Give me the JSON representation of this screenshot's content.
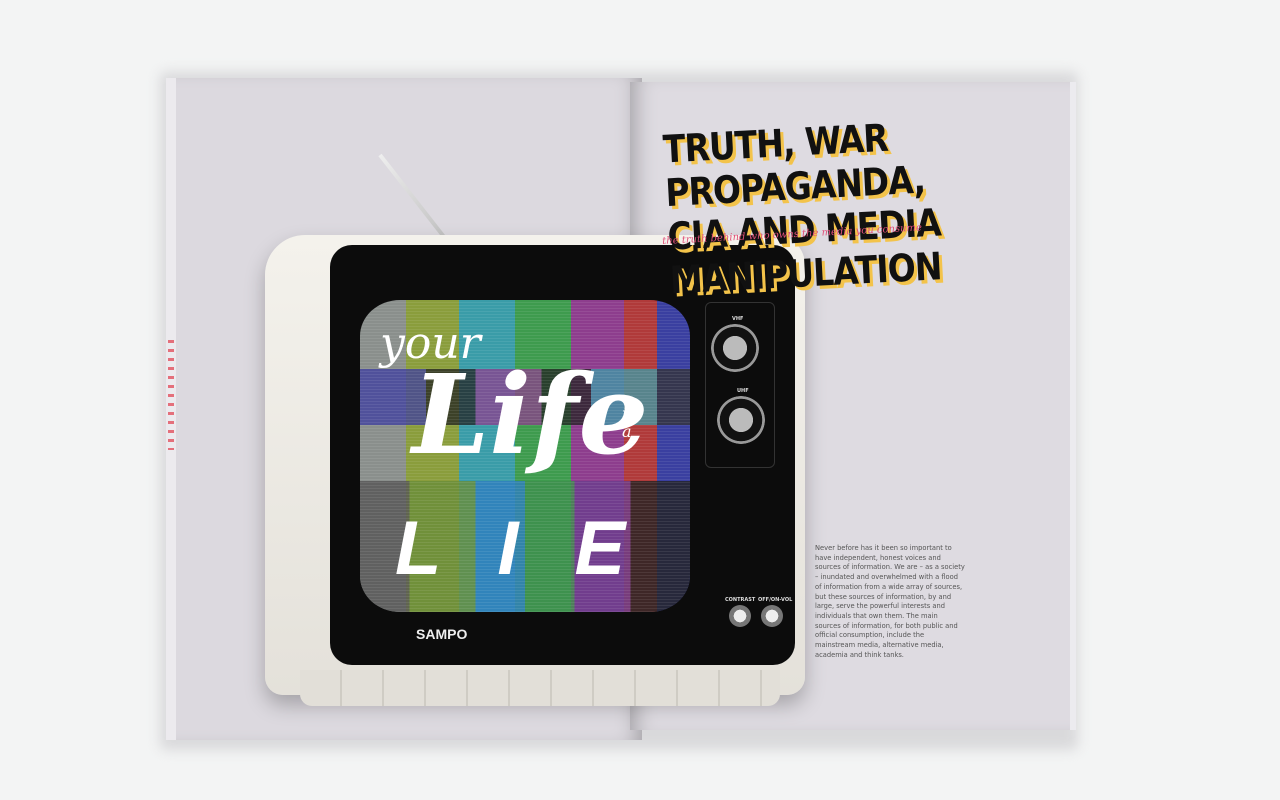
{
  "spread": {
    "headline": "TRUTH, WAR PROPAGANDA, CIA AND MEDIA MANIPULATION",
    "subtitle": "the truth behind who owns the media you consume",
    "body": "Never before has it been so important to have independent, honest voices and sources of information. We are – as a society – inundated and overwhelmed with a flood of information from a wide array of sources, but these sources of information, by and large, serve the powerful interests and individuals that own them. The main sources of information, for both public and official consumption, include the mainstream media, alternative media, academia and think tanks."
  },
  "tv": {
    "screen_text": {
      "your": "your",
      "life": "Life",
      "is_a": "is a",
      "lie": "LIE"
    },
    "brand": "SAMPO",
    "labels": {
      "vhf": "VHF",
      "uhf": "UHF",
      "contrast": "CONTRAST",
      "onoff": "OFF/ON-VOL"
    }
  },
  "colors": {
    "page": "#dcd9df",
    "headline_shadow": "#f3c34a",
    "subtitle": "#e0507a"
  }
}
